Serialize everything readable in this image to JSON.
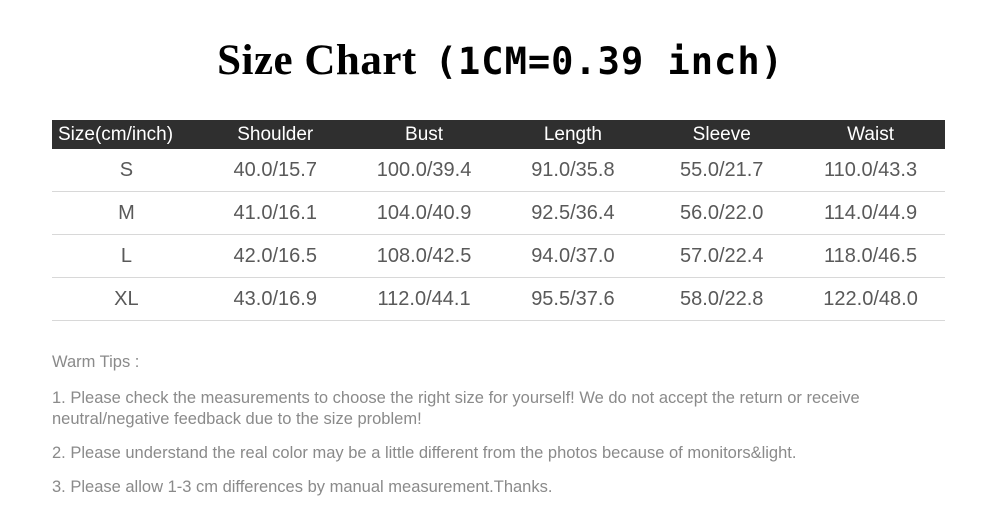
{
  "title": {
    "main": "Size Chart",
    "sub": "(1CM=0.39 inch)"
  },
  "table": {
    "headers": [
      "Size(cm/inch)",
      "Shoulder",
      "Bust",
      "Length",
      "Sleeve",
      "Waist"
    ],
    "rows": [
      {
        "size": "S",
        "shoulder": "40.0/15.7",
        "bust": "100.0/39.4",
        "length": "91.0/35.8",
        "sleeve": "55.0/21.7",
        "waist": "110.0/43.3"
      },
      {
        "size": "M",
        "shoulder": "41.0/16.1",
        "bust": "104.0/40.9",
        "length": "92.5/36.4",
        "sleeve": "56.0/22.0",
        "waist": "114.0/44.9"
      },
      {
        "size": "L",
        "shoulder": "42.0/16.5",
        "bust": "108.0/42.5",
        "length": "94.0/37.0",
        "sleeve": "57.0/22.4",
        "waist": "118.0/46.5"
      },
      {
        "size": "XL",
        "shoulder": "43.0/16.9",
        "bust": "112.0/44.1",
        "length": "95.5/37.6",
        "sleeve": "58.0/22.8",
        "waist": "122.0/48.0"
      }
    ]
  },
  "tips": {
    "heading": "Warm Tips :",
    "items": [
      "1. Please check the measurements to choose the right size for yourself! We do not accept the return or receive neutral/negative feedback due to the size problem!",
      "2. Please understand the real color may be a little different from the photos because of monitors&light.",
      "3. Please allow 1-3 cm differences by manual measurement.Thanks."
    ]
  },
  "colors": {
    "header_bg": "#2f2f2f",
    "header_text": "#ffffff",
    "cell_text": "#595959",
    "row_divider": "#d8d8d8",
    "tips_text": "#8a8a8a",
    "title_text": "#000000",
    "page_bg": "#ffffff"
  }
}
